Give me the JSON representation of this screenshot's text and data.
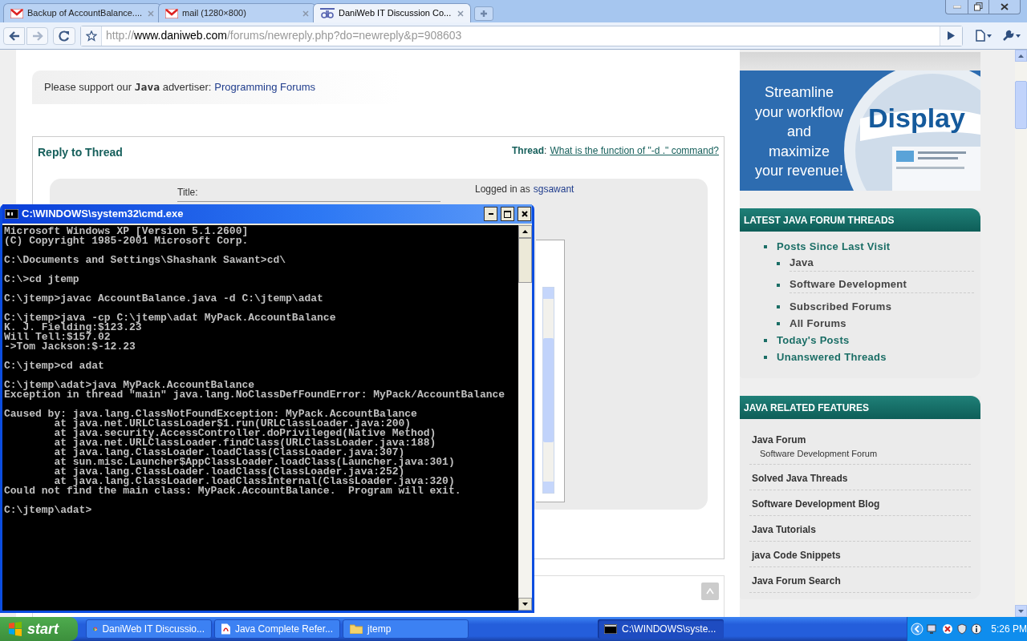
{
  "browser": {
    "tabs": [
      {
        "title": "Backup of AccountBalance....",
        "kind": "mail",
        "selected": false
      },
      {
        "title": "mail (1280×800)",
        "kind": "mail",
        "selected": false
      },
      {
        "title": "DaniWeb IT Discussion Co...",
        "kind": "site",
        "selected": true
      }
    ],
    "url": {
      "scheme": "http://",
      "host": "www.daniweb.com",
      "path": "/forums/newreply.php?do=newreply&p=908603"
    }
  },
  "page": {
    "support": {
      "text": "Please support our **Java** advertiser:",
      "link": "Programming Forums"
    },
    "reply": {
      "heading": "Reply to Thread",
      "thread_label": "**Thread**:",
      "thread_link": "What is the function of \"-d .\" command?",
      "title_label": "Title:",
      "logged_in": "Logged in as",
      "user": "sgsawant"
    },
    "ad": {
      "lines": [
        "Streamline",
        "your workflow",
        "and",
        "maximize",
        "your revenue!"
      ],
      "brand": "Display"
    },
    "latest": {
      "heading": "LATEST JAVA FORUM THREADS",
      "items": [
        {
          "label": "Posts Since Last Visit",
          "children": [
            {
              "label": "Java"
            },
            {
              "label": "Software Development"
            },
            {
              "label": "Subscribed Forums"
            },
            {
              "label": "All Forums"
            }
          ]
        },
        {
          "label": "Today's Posts"
        },
        {
          "label": "Unanswered Threads"
        }
      ]
    },
    "features": {
      "heading": "JAVA RELATED FEATURES",
      "items": [
        {
          "label": "Java Forum",
          "sub": "Software Development Forum"
        },
        {
          "label": "Solved Java Threads"
        },
        {
          "label": "Software Development Blog"
        },
        {
          "label": "Java Tutorials"
        },
        {
          "label": "java Code Snippets"
        },
        {
          "label": "Java Forum Search"
        }
      ]
    }
  },
  "console": {
    "title": "C:\\WINDOWS\\system32\\cmd.exe",
    "blocks": [
      [
        "Microsoft Windows XP [Version 5.1.2600]",
        "(C) Copyright 1985-2001 Microsoft Corp."
      ],
      [
        "C:\\Documents and Settings\\Shashank Sawant>cd\\"
      ],
      [
        "C:\\>cd jtemp"
      ],
      [
        "C:\\jtemp>javac AccountBalance.java -d C:\\jtemp\\adat"
      ],
      [
        "C:\\jtemp>java -cp C:\\jtemp\\adat MyPack.AccountBalance",
        "K. J. Fielding:$123.23",
        "Will Tell:$157.02",
        "->Tom Jackson:$-12.23"
      ],
      [
        "C:\\jtemp>cd adat"
      ],
      [
        "C:\\jtemp\\adat>java MyPack.AccountBalance",
        "Exception in thread \"main\" java.lang.NoClassDefFoundError: MyPack/AccountBalance"
      ],
      [
        "Caused by: java.lang.ClassNotFoundException: MyPack.AccountBalance",
        "        at java.net.URLClassLoader$1.run(URLClassLoader.java:200)",
        "        at java.security.AccessController.doPrivileged(Native Method)",
        "        at java.net.URLClassLoader.findClass(URLClassLoader.java:188)",
        "        at java.lang.ClassLoader.loadClass(ClassLoader.java:307)",
        "        at sun.misc.Launcher$AppClassLoader.loadClass(Launcher.java:301)",
        "        at java.lang.ClassLoader.loadClass(ClassLoader.java:252)",
        "        at java.lang.ClassLoader.loadClassInternal(ClassLoader.java:320)",
        "Could not find the main class: MyPack.AccountBalance.  Program will exit."
      ],
      [
        "C:\\jtemp\\adat>"
      ]
    ]
  },
  "taskbar": {
    "start": "start",
    "tasks": [
      {
        "label": "DaniWeb IT Discussio...",
        "kind": "browser",
        "selected": false
      },
      {
        "label": "Java Complete Refer...",
        "kind": "pdf",
        "selected": false
      },
      {
        "label": "jtemp",
        "kind": "folder",
        "selected": false
      },
      {
        "label": "C:\\WINDOWS\\syste...",
        "kind": "console",
        "selected": true
      }
    ],
    "clock": "5:26 PM"
  }
}
